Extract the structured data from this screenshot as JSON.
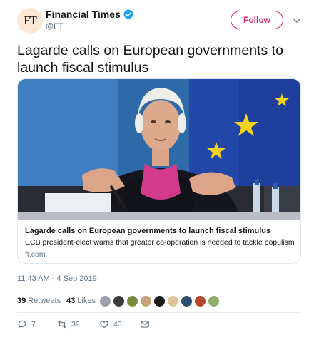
{
  "author": {
    "avatar_text": "FT",
    "display_name": "Financial Times",
    "handle": "@FT"
  },
  "follow_label": "Follow",
  "tweet_text": "Lagarde calls on European governments to launch fiscal stimulus",
  "card": {
    "title": "Lagarde calls on European governments to launch fiscal stimulus",
    "description": "ECB president-elect warns that greater co-operation is needed to tackle populism",
    "domain": "ft.com"
  },
  "timestamp": "11:43 AM - 4 Sep 2019",
  "stats": {
    "retweets_count": "39",
    "retweets_label": "Retweets",
    "likes_count": "43",
    "likes_label": "Likes"
  },
  "actions": {
    "reply_count": "7",
    "retweet_count": "39",
    "like_count": "43"
  },
  "colors": {
    "accent": "#e0245e",
    "verified": "#1da1f2",
    "muted": "#657786",
    "eu_blue": "#1f3f9c",
    "eu_star": "#f4d31a"
  },
  "icons": [
    "verified-badge-icon",
    "chevron-down-icon",
    "reply-icon",
    "retweet-icon",
    "heart-icon",
    "message-icon"
  ]
}
